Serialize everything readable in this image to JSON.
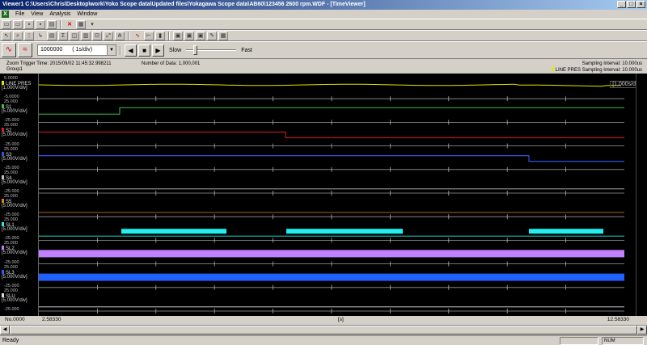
{
  "window": {
    "title": "Viewer1 C:\\Users\\Chris\\Desktop\\work\\Yoko Scope data\\Updated files\\Yokagawa Scope data\\AB60\\123456 2600 rpm.WDF - [TimeViewer]",
    "minimize": "_",
    "restore": "□",
    "close": "×"
  },
  "menu": {
    "app_icon": "X",
    "items": [
      {
        "label": "File",
        "key": "F"
      },
      {
        "label": "View",
        "key": "V"
      },
      {
        "label": "Analysis",
        "key": "A"
      },
      {
        "label": "Window",
        "key": "W"
      }
    ]
  },
  "playback": {
    "count": "1000000",
    "time_div": "( 1s/div)",
    "slow": "Slow",
    "fast": "Fast",
    "speed_level": 0.15
  },
  "info": {
    "zoom_trigger": "Zoom Trigger Time: 2015/09/02 11:45:32.998211",
    "group": "Group1",
    "num_data": "Number of Data: 1,000,001",
    "sampling": "Sampling Interval:  10.000us",
    "line_pres_sampling": "LINE PRES Sampling Interval:  10.000us"
  },
  "plot": {
    "div_label": "[1.000s/div]",
    "background": "#000000",
    "channels": [
      {
        "name": "LINE PRES",
        "color": "#e6e600",
        "scale": "[1.000V/div]",
        "top": "5.0000",
        "bottom": "-5.0000"
      },
      {
        "name": "S1",
        "color": "#40c040",
        "scale": "[5.000V/div]",
        "top": "25.000",
        "bottom": "-25.000"
      },
      {
        "name": "S2",
        "color": "#e02020",
        "scale": "[5.000V/div]",
        "top": "25.000",
        "bottom": "-25.000"
      },
      {
        "name": "S3",
        "color": "#3050e0",
        "scale": "[5.000V/div]",
        "top": "25.000",
        "bottom": "-25.000"
      },
      {
        "name": "S4",
        "color": "#c0c0c0",
        "scale": "[5.000V/div]",
        "top": "25.000",
        "bottom": "-25.000"
      },
      {
        "name": "S5",
        "color": "#e08020",
        "scale": "[5.000V/div]",
        "top": "25.000",
        "bottom": "-25.000"
      },
      {
        "name": "SL1",
        "color": "#20f0f0",
        "scale": "[5.000V/div]",
        "top": "25.000",
        "bottom": "-25.000"
      },
      {
        "name": "SL2",
        "color": "#c080ff",
        "scale": "[5.000V/div]",
        "top": "25.000",
        "bottom": "-25.000"
      },
      {
        "name": "SL3",
        "color": "#2060ff",
        "scale": "[5.000V/div]",
        "top": "25.000",
        "bottom": "-25.000"
      },
      {
        "name": "SLU",
        "color": "#e0e0e0",
        "scale": "[5.000V/div]",
        "top": "25.000",
        "bottom": "-25.000"
      }
    ]
  },
  "xaxis": {
    "no": "No.0000",
    "start": "2.58330",
    "unit": "[s]",
    "end": "12.58330"
  },
  "status": {
    "ready": "Ready",
    "num": "NUM"
  }
}
